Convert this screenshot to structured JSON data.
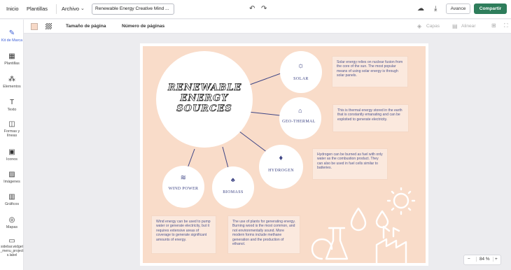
{
  "topbar": {
    "home": "Inicio",
    "templates": "Plantillas",
    "file": "Archivo",
    "doc_title": "Renewable Energy Creative Mind ...",
    "advance": "Avance",
    "share": "Compartir"
  },
  "toolbar": {
    "page_size": "Tamaño de página",
    "page_number": "Número de páginas",
    "layers": "Capas",
    "align": "Alinear"
  },
  "sidebar": {
    "items": [
      "Kit de Marca",
      "Plantillas",
      "Elementos",
      "Texto",
      "Formas y líneas",
      "Iconos",
      "Imágenes",
      "Gráficos",
      "Mapas",
      "sidebar.widget_menu_projects.label"
    ]
  },
  "poster": {
    "title": "RENEWABLE ENERGY SOURCES",
    "nodes": [
      "SOLAR",
      "GEO-THERMAL",
      "HYDROGEN",
      "BIOMASS",
      "WIND POWER"
    ],
    "texts": [
      "Solar energy relies on nuclear fusion from the core of the sun. The most popular means of using solar energy is through solar panels.",
      "This is thermal energy stored in the earth that is constantly emanating and can be exploited to generate electricity.",
      "Hydrogen can be burned as fuel with only water as the combustion product. They can also be used in fuel cells similar to batteries.",
      "Wind energy can be used to pump water or generate electricity, but it requires extensive areas of coverage to generate significant amounts of energy.",
      "The use of plants for generating energy. Burning wood is the most common, and not environmentally sound. More modern forms include methane generation and the production of ethanol."
    ],
    "accent": "#3e4585",
    "background": "#f9dcc9"
  },
  "zoom": {
    "minus": "−",
    "value": "84 %",
    "plus": "+"
  }
}
